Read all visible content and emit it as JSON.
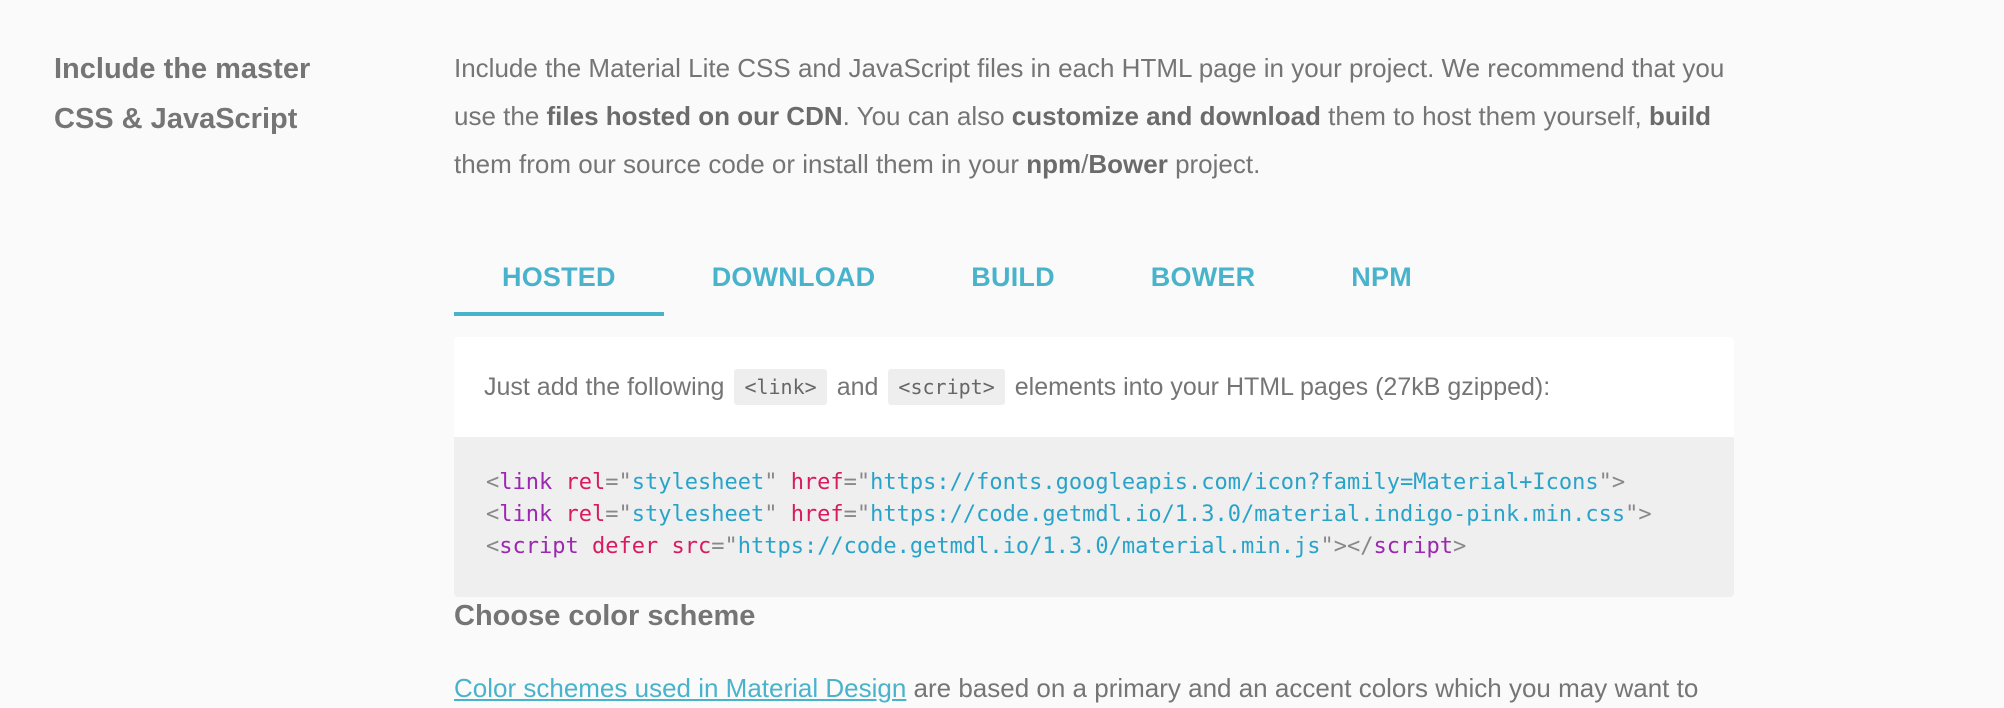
{
  "section": {
    "title_line1": "Include the master",
    "title_line2": "CSS & JavaScript"
  },
  "intro": {
    "t1": "Include the Material Lite CSS and JavaScript files in each HTML page in your project. We recommend that you use the ",
    "b1": "files hosted on our CDN",
    "t2": ". You can also ",
    "b2": "customize and download",
    "t3": " them to host them yourself, ",
    "b3": "build",
    "t4": " them from our source code or install them in your ",
    "b4": "npm",
    "t5": "/",
    "b5": "Bower",
    "t6": " project."
  },
  "tabs": [
    {
      "label": "HOSTED",
      "active": true
    },
    {
      "label": "DOWNLOAD",
      "active": false
    },
    {
      "label": "BUILD",
      "active": false
    },
    {
      "label": "BOWER",
      "active": false
    },
    {
      "label": "NPM",
      "active": false
    }
  ],
  "panel": {
    "text_before": "Just add the following",
    "chip1": "<link>",
    "text_mid": "and",
    "chip2": "<script>",
    "text_after": "elements into your HTML pages (27kB gzipped):"
  },
  "code": {
    "line1": {
      "tag": "link",
      "a1": "rel",
      "v1": "stylesheet",
      "a2": "href",
      "v2": "https://fonts.googleapis.com/icon?family=Material+Icons"
    },
    "line2": {
      "tag": "link",
      "a1": "rel",
      "v1": "stylesheet",
      "a2": "href",
      "v2": "https://code.getmdl.io/1.3.0/material.indigo-pink.min.css"
    },
    "line3": {
      "tag": "script",
      "a0": "defer",
      "a1": "src",
      "v1": "https://code.getmdl.io/1.3.0/material.min.js",
      "close": "script"
    }
  },
  "color_scheme": {
    "heading": "Choose color scheme",
    "link": "Color schemes used in Material Design",
    "text": " are based on a primary and an accent colors which you may want to"
  },
  "colors": {
    "accent": "#4ab3cc",
    "tag": "#9c27b0",
    "attr": "#d81b60",
    "value": "#29a3c8"
  }
}
